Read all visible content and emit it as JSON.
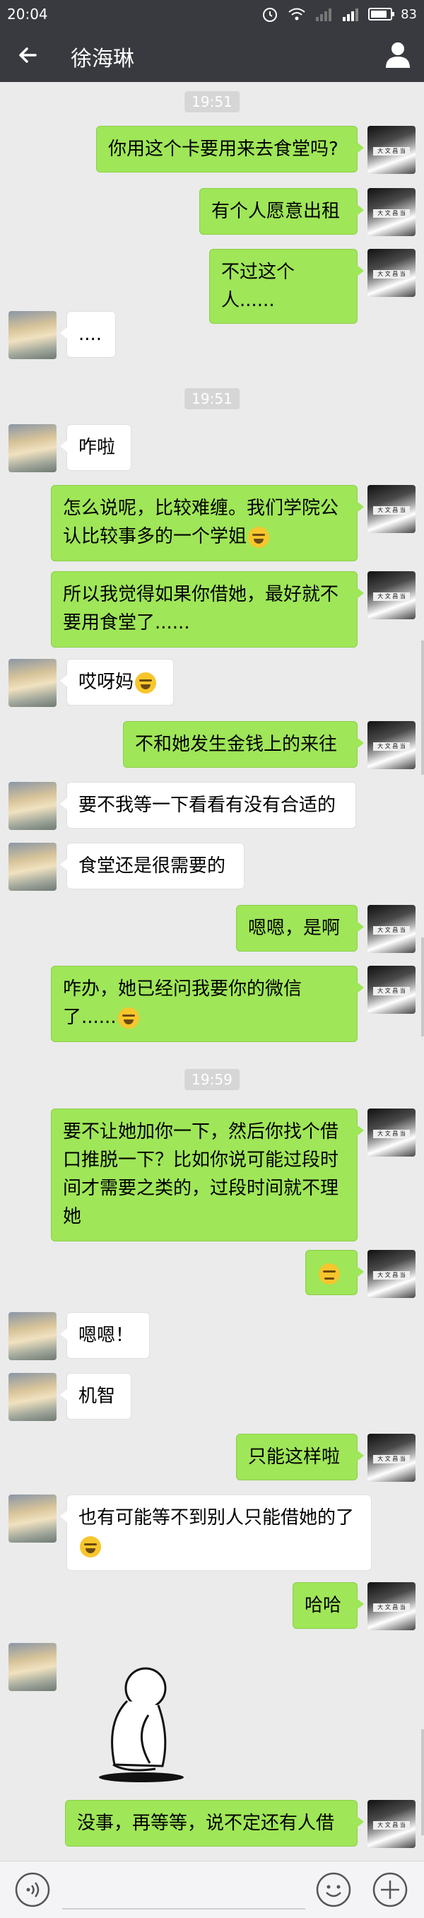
{
  "status_bar": {
    "time": "20:04",
    "battery": "83",
    "battery_level": 0.83
  },
  "header": {
    "title": "徐海琳"
  },
  "chat": {
    "timestamps": [
      "19:51",
      "19:51",
      "19:59"
    ],
    "messages": [
      {
        "from": "me",
        "text": "你用这个卡要用来去食堂吗?"
      },
      {
        "from": "me",
        "text": "有个人愿意出租"
      },
      {
        "from": "me",
        "text": "不过这个人......"
      },
      {
        "from": "them",
        "text": "...."
      },
      {
        "from": "them",
        "text": "咋啦"
      },
      {
        "from": "me",
        "text": "怎么说呢，比较难缠。我们学院公认比较事多的一个学姐",
        "emoji": "laugh-cry-emoji"
      },
      {
        "from": "me",
        "text": "所以我觉得如果你借她，最好就不要用食堂了......"
      },
      {
        "from": "them",
        "text": "哎呀妈",
        "emoji": "laugh-cry-emoji"
      },
      {
        "from": "me",
        "text": "不和她发生金钱上的来往"
      },
      {
        "from": "them",
        "text": "要不我等一下看看有没有合适的"
      },
      {
        "from": "them",
        "text": "食堂还是很需要的"
      },
      {
        "from": "me",
        "text": "嗯嗯，是啊"
      },
      {
        "from": "me",
        "text": "咋办，她已经问我要你的微信了......",
        "emoji": "laugh-cry-emoji"
      },
      {
        "from": "me",
        "text": "要不让她加你一下，然后你找个借口推脱一下？比如你说可能过段时间才需要之类的，过段时间就不理她"
      },
      {
        "from": "me",
        "text": "",
        "emoji": "sly-smile-emoji"
      },
      {
        "from": "them",
        "text": "嗯嗯！"
      },
      {
        "from": "them",
        "text": "机智"
      },
      {
        "from": "me",
        "text": "只能这样啦"
      },
      {
        "from": "them",
        "text": "也有可能等不到别人只能借她的了",
        "emoji": "laugh-cry-emoji"
      },
      {
        "from": "me",
        "text": "哈哈"
      },
      {
        "from": "them",
        "sticker": "sitting-figure-sticker"
      },
      {
        "from": "me",
        "text": "没事，再等等，说不定还有人借"
      }
    ]
  },
  "avatars": {
    "me_sign": "大 文 昌 当"
  },
  "icons": {
    "back": "back-arrow-icon",
    "profile": "person-icon",
    "voice": "voice-icon",
    "emoji": "emoji-icon",
    "plus": "plus-icon"
  },
  "colors": {
    "header_bg": "#393a3f",
    "me_bubble": "#9fe658",
    "them_bubble": "#ffffff",
    "chat_bg": "#ebebeb"
  }
}
